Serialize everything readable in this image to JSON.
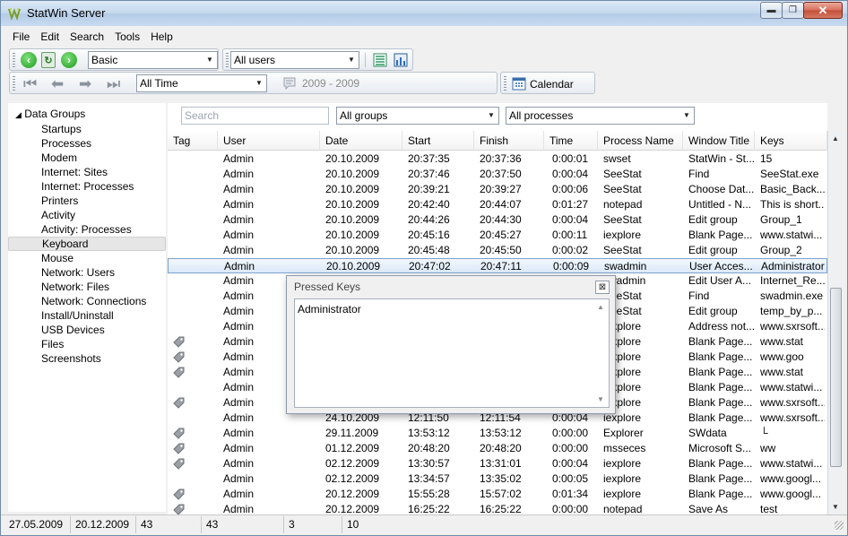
{
  "window": {
    "title": "StatWin Server",
    "min_glyph": "▬",
    "max_glyph": "❐",
    "close_glyph": "✕"
  },
  "menu": [
    "File",
    "Edit",
    "Search",
    "Tools",
    "Help"
  ],
  "toolbar1": {
    "view_combo": "Basic",
    "users_combo": "All users"
  },
  "toolbar2": {
    "period_combo": "All Time",
    "range_label": "2009 - 2009",
    "calendar_label": "Calendar"
  },
  "sidebar": {
    "root": "Data Groups",
    "items": [
      "Startups",
      "Processes",
      "Modem",
      "Internet: Sites",
      "Internet: Processes",
      "Printers",
      "Activity",
      "Activity: Processes",
      "Keyboard",
      "Mouse",
      "Network: Users",
      "Network: Files",
      "Network: Connections",
      "Install/Uninstall",
      "USB Devices",
      "Files",
      "Screenshots"
    ],
    "selected_index": 8
  },
  "filters": {
    "search_placeholder": "Search",
    "groups_combo": "All groups",
    "processes_combo": "All processes"
  },
  "grid": {
    "columns": [
      "Tag",
      "User",
      "Date",
      "Start",
      "Finish",
      "Time",
      "Process Name",
      "Window Title",
      "Keys"
    ],
    "rows": [
      {
        "tag": false,
        "user": "Admin",
        "date": "20.10.2009",
        "start": "20:37:35",
        "finish": "20:37:36",
        "time": "0:00:01",
        "process": "swset",
        "title": "StatWin - St...",
        "keys": "15"
      },
      {
        "tag": false,
        "user": "Admin",
        "date": "20.10.2009",
        "start": "20:37:46",
        "finish": "20:37:50",
        "time": "0:00:04",
        "process": "SeeStat",
        "title": "Find",
        "keys": "SeeStat.exe"
      },
      {
        "tag": false,
        "user": "Admin",
        "date": "20.10.2009",
        "start": "20:39:21",
        "finish": "20:39:27",
        "time": "0:00:06",
        "process": "SeeStat",
        "title": "Choose Dat...",
        "keys": "Basic_Back..."
      },
      {
        "tag": false,
        "user": "Admin",
        "date": "20.10.2009",
        "start": "20:42:40",
        "finish": "20:44:07",
        "time": "0:01:27",
        "process": "notepad",
        "title": "Untitled - N...",
        "keys": "This is short..."
      },
      {
        "tag": false,
        "user": "Admin",
        "date": "20.10.2009",
        "start": "20:44:26",
        "finish": "20:44:30",
        "time": "0:00:04",
        "process": "SeeStat",
        "title": "Edit group",
        "keys": "Group_1"
      },
      {
        "tag": false,
        "user": "Admin",
        "date": "20.10.2009",
        "start": "20:45:16",
        "finish": "20:45:27",
        "time": "0:00:11",
        "process": "iexplore",
        "title": "Blank Page...",
        "keys": "www.statwi..."
      },
      {
        "tag": false,
        "user": "Admin",
        "date": "20.10.2009",
        "start": "20:45:48",
        "finish": "20:45:50",
        "time": "0:00:02",
        "process": "SeeStat",
        "title": "Edit group",
        "keys": "Group_2"
      },
      {
        "tag": false,
        "user": "Admin",
        "date": "20.10.2009",
        "start": "20:47:02",
        "finish": "20:47:11",
        "time": "0:00:09",
        "process": "swadmin",
        "title": "User Acces...",
        "keys": "Administrator",
        "selected": true
      },
      {
        "tag": false,
        "user": "Admin",
        "date": "",
        "start": "",
        "finish": "",
        "time": "",
        "process": "swadmin",
        "title": "Edit User A...",
        "keys": "Internet_Re..."
      },
      {
        "tag": false,
        "user": "Admin",
        "date": "",
        "start": "",
        "finish": "",
        "time": "",
        "process": "SeeStat",
        "title": "Find",
        "keys": "swadmin.exe"
      },
      {
        "tag": false,
        "user": "Admin",
        "date": "",
        "start": "",
        "finish": "",
        "time": "",
        "process": "SeeStat",
        "title": "Edit group",
        "keys": "temp_by_p..."
      },
      {
        "tag": false,
        "user": "Admin",
        "date": "",
        "start": "",
        "finish": "",
        "time": "",
        "process": "iexplore",
        "title": "Address not...",
        "keys": "www.sxrsoft..."
      },
      {
        "tag": true,
        "user": "Admin",
        "date": "",
        "start": "",
        "finish": "",
        "time": "",
        "process": "iexplore",
        "title": "Blank Page...",
        "keys": "www.stat"
      },
      {
        "tag": true,
        "user": "Admin",
        "date": "",
        "start": "",
        "finish": "",
        "time": "",
        "process": "iexplore",
        "title": "Blank Page...",
        "keys": "www.goo"
      },
      {
        "tag": true,
        "user": "Admin",
        "date": "",
        "start": "",
        "finish": "",
        "time": "",
        "process": "iexplore",
        "title": "Blank Page...",
        "keys": "www.stat"
      },
      {
        "tag": false,
        "user": "Admin",
        "date": "",
        "start": "",
        "finish": "",
        "time": "",
        "process": "iexplore",
        "title": "Blank Page...",
        "keys": "www.statwi..."
      },
      {
        "tag": true,
        "user": "Admin",
        "date": "",
        "start": "",
        "finish": "",
        "time": "",
        "process": "iexplore",
        "title": "Blank Page...",
        "keys": "www.sxrsoft..."
      },
      {
        "tag": false,
        "user": "Admin",
        "date": "24.10.2009",
        "start": "12:11:50",
        "finish": "12:11:54",
        "time": "0:00:04",
        "process": "iexplore",
        "title": "Blank Page...",
        "keys": "www.sxrsoft..."
      },
      {
        "tag": true,
        "user": "Admin",
        "date": "29.11.2009",
        "start": "13:53:12",
        "finish": "13:53:12",
        "time": "0:00:00",
        "process": "Explorer",
        "title": "SWdata",
        "keys": "└"
      },
      {
        "tag": true,
        "user": "Admin",
        "date": "01.12.2009",
        "start": "20:48:20",
        "finish": "20:48:20",
        "time": "0:00:00",
        "process": "msseces",
        "title": "Microsoft S...",
        "keys": "ww"
      },
      {
        "tag": true,
        "user": "Admin",
        "date": "02.12.2009",
        "start": "13:30:57",
        "finish": "13:31:01",
        "time": "0:00:04",
        "process": "iexplore",
        "title": "Blank Page...",
        "keys": "www.statwi..."
      },
      {
        "tag": false,
        "user": "Admin",
        "date": "02.12.2009",
        "start": "13:34:57",
        "finish": "13:35:02",
        "time": "0:00:05",
        "process": "iexplore",
        "title": "Blank Page...",
        "keys": "www.googl..."
      },
      {
        "tag": true,
        "user": "Admin",
        "date": "20.12.2009",
        "start": "15:55:28",
        "finish": "15:57:02",
        "time": "0:01:34",
        "process": "iexplore",
        "title": "Blank Page...",
        "keys": "www.googl..."
      },
      {
        "tag": true,
        "user": "Admin",
        "date": "20.12.2009",
        "start": "16:25:22",
        "finish": "16:25:22",
        "time": "0:00:00",
        "process": "notepad",
        "title": "Save As",
        "keys": "test"
      }
    ]
  },
  "popup": {
    "title": "Pressed Keys",
    "close_glyph": "⊠",
    "text": "Administrator"
  },
  "status": [
    "27.05.2009",
    "20.12.2009",
    "43",
    "43",
    "3",
    "10"
  ]
}
